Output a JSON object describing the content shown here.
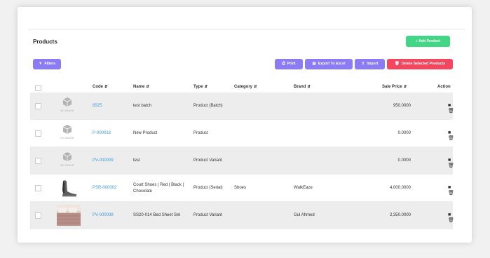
{
  "header": {
    "title": "Products",
    "add_label": "+ Add Product"
  },
  "toolbar": {
    "filters_label": "Filters",
    "print_label": "Print",
    "export_label": "Export To Excel",
    "import_label": "Import",
    "delete_label": "Delete Selected Products"
  },
  "colors": {
    "primary": "#8b7cf6",
    "success": "#42d687",
    "danger": "#f2475f",
    "link": "#3a9ad9"
  },
  "table": {
    "columns": {
      "code": "Code",
      "name": "Name",
      "type": "Type",
      "category": "Category",
      "brand": "Brand",
      "sale_price": "Sale Price",
      "action": "Action"
    },
    "no_image_label": "NO IMAGE",
    "rows": [
      {
        "image": "no-image",
        "code": "8525",
        "name": "test batch",
        "name2": "",
        "type": "Product (Batch)",
        "category": "",
        "brand": "",
        "price": "950.0000"
      },
      {
        "image": "no-image",
        "code": "P-000018",
        "name": "New Product",
        "name2": "",
        "type": "Product",
        "category": "",
        "brand": "",
        "price": "0.0000"
      },
      {
        "image": "no-image",
        "code": "PV-000009",
        "name": "test",
        "name2": "",
        "type": "Product Variant",
        "category": "",
        "brand": "",
        "price": "0.0000"
      },
      {
        "image": "shoe-photo",
        "code": "PSR-000002",
        "name": "Court Shoes | Red | Black |",
        "name2": "Chocolate",
        "type": "Product (Serial)",
        "category": "Shoes",
        "brand": "WalkEaze",
        "price": "4,000.0000"
      },
      {
        "image": "bedsheet-photo",
        "code": "PV-000008",
        "name": "SS20-014 Bed Sheet Set",
        "name2": "",
        "type": "Product Variant",
        "category": "",
        "brand": "Gul Ahmed",
        "price": "2,350.0000"
      }
    ]
  }
}
